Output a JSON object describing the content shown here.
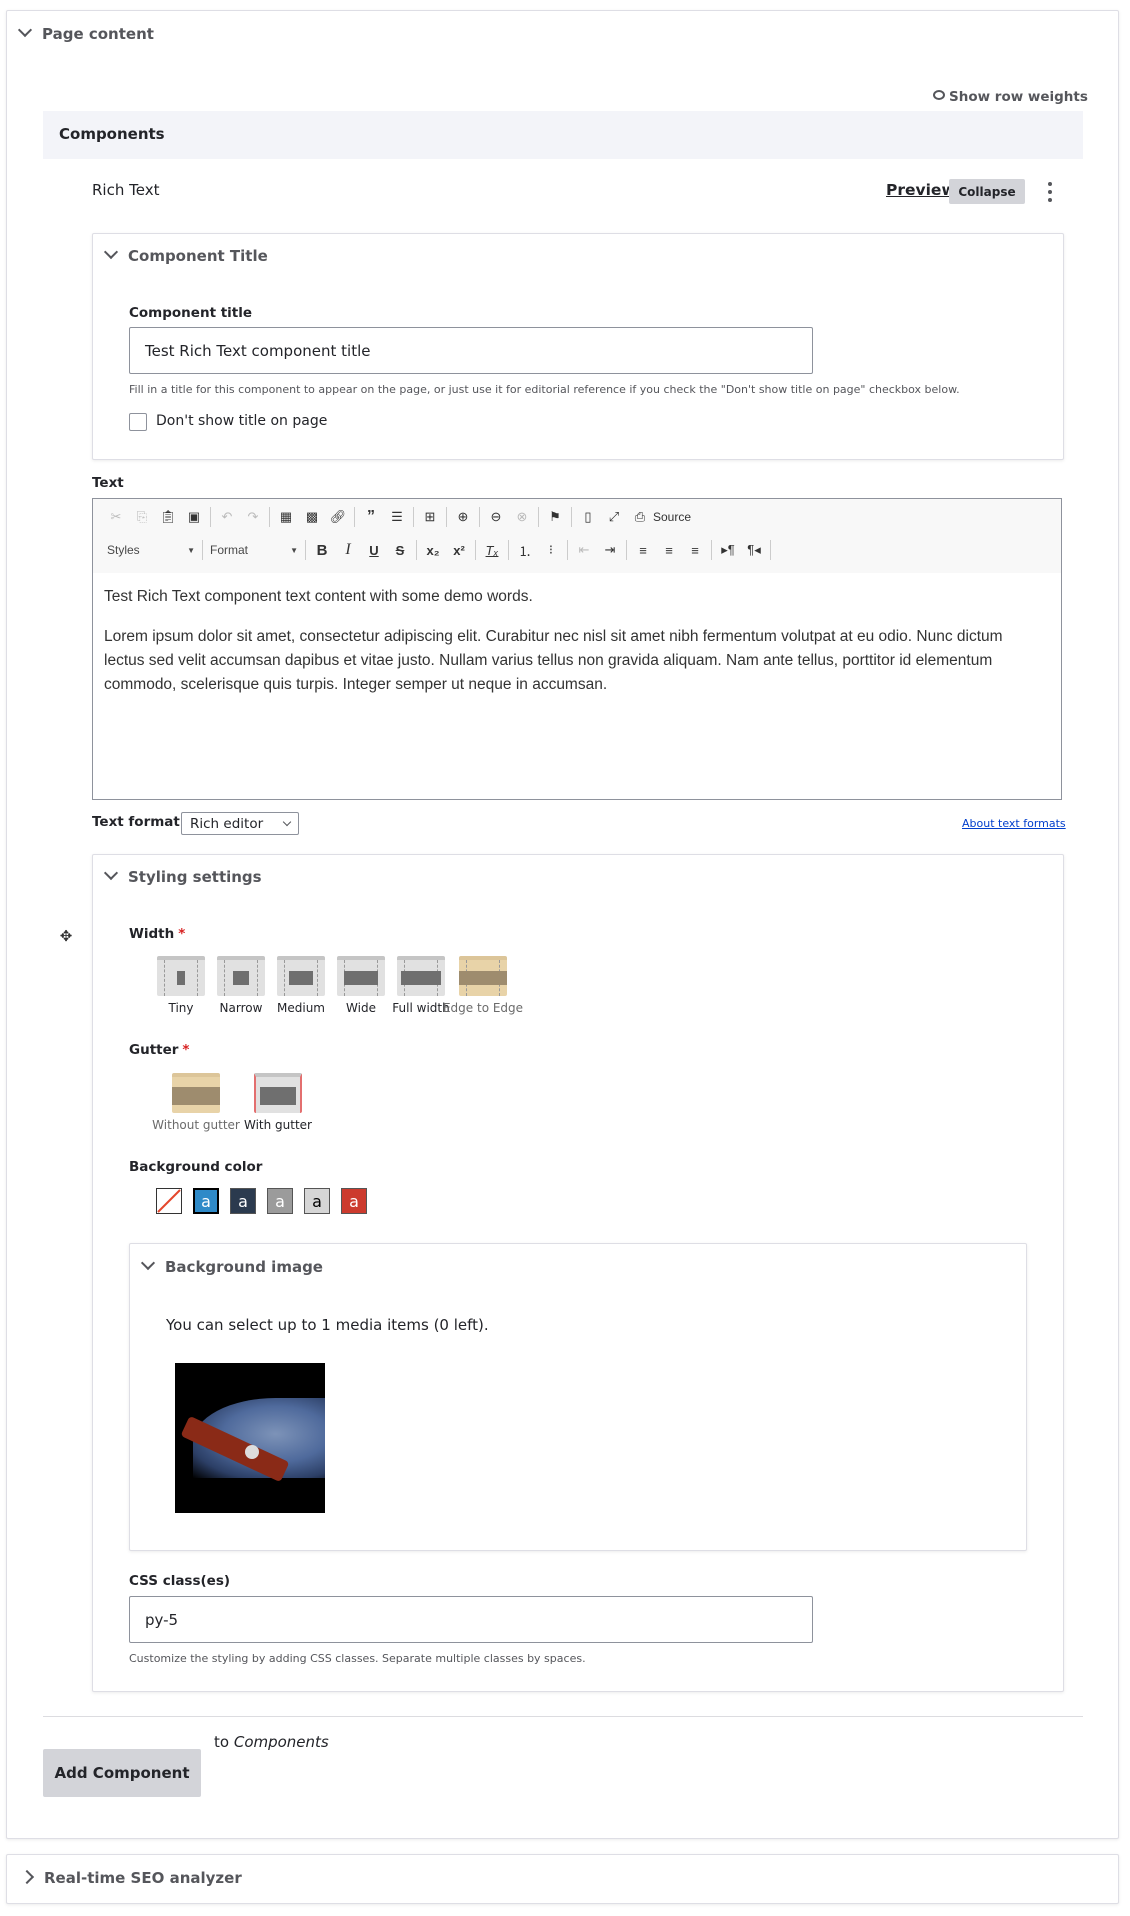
{
  "page_content": {
    "title": "Page content",
    "show_row_weights": "Show row weights",
    "components_heading": "Components",
    "component": {
      "type_label": "Rich Text",
      "preview_label": "Preview",
      "collapse_label": "Collapse",
      "title_section": {
        "title": "Component Title",
        "field_label": "Component title",
        "value": "Test Rich Text component title",
        "help": "Fill in a title for this component to appear on the page, or just use it for editorial reference if you check the \"Don't show title on page\" checkbox below.",
        "checkbox_label": "Don't show title on page",
        "checkbox_checked": false
      },
      "text": {
        "label": "Text",
        "toolbar_row1": [
          "cut",
          "copy",
          "paste",
          "paste-from-word",
          "undo",
          "redo",
          "insert-media",
          "media-gallery",
          "link",
          "blockquote",
          "horizontal-rule",
          "table",
          "anchor-add",
          "unlink-anchor",
          "remove-anchor",
          "flag",
          "show-blocks",
          "maximize"
        ],
        "source_label": "Source",
        "styles_label": "Styles",
        "format_label": "Format",
        "paragraphs": [
          "Test Rich Text component text content with some demo words.",
          "Lorem ipsum dolor sit amet, consectetur adipiscing elit. Curabitur nec nisl sit amet nibh fermentum volutpat at eu odio. Nunc dictum lectus sed velit accumsan dapibus et vitae justo. Nullam varius tellus non gravida aliquam. Nam ante tellus, porttitor id elementum commodo, scelerisque quis turpis. Integer semper ut neque in accumsan."
        ],
        "format_label_text": "Text format",
        "format_selected": "Rich editor",
        "about_formats": "About text formats"
      },
      "styling": {
        "title": "Styling settings",
        "width_label": "Width",
        "width_options": [
          "Tiny",
          "Narrow",
          "Medium",
          "Wide",
          "Full width",
          "Edge to Edge"
        ],
        "width_selected": "Edge to Edge",
        "gutter_label": "Gutter",
        "gutter_options": [
          "Without gutter",
          "With gutter"
        ],
        "gutter_selected": "Without gutter",
        "bg_color_label": "Background color",
        "bg_colors": [
          {
            "name": "none",
            "color": "#ffffff",
            "glyph": ""
          },
          {
            "name": "blue",
            "color": "#2f8ac8",
            "glyph": "a"
          },
          {
            "name": "dark-navy",
            "color": "#2b3a4e",
            "glyph": "a"
          },
          {
            "name": "gray",
            "color": "#9b9b9b",
            "glyph": "a"
          },
          {
            "name": "light-gray",
            "color": "#d6d6d6",
            "glyph": "a"
          },
          {
            "name": "red",
            "color": "#cc3b2e",
            "glyph": "a"
          }
        ],
        "bg_color_selected": "blue",
        "bg_image": {
          "title": "Background image",
          "media_text": "You can select up to 1 media items (0 left)."
        },
        "css_label": "CSS class(es)",
        "css_value": "py-5",
        "css_help": "Customize the styling by adding CSS classes. Separate multiple classes by spaces."
      }
    },
    "add_component_label": "Add Component",
    "to_text": "to",
    "to_target": "Components"
  },
  "seo_panel": {
    "title": "Real-time SEO analyzer"
  },
  "colors": {
    "link": "#003ecc",
    "required": "#d72222",
    "components_band": "#f3f4f9"
  }
}
